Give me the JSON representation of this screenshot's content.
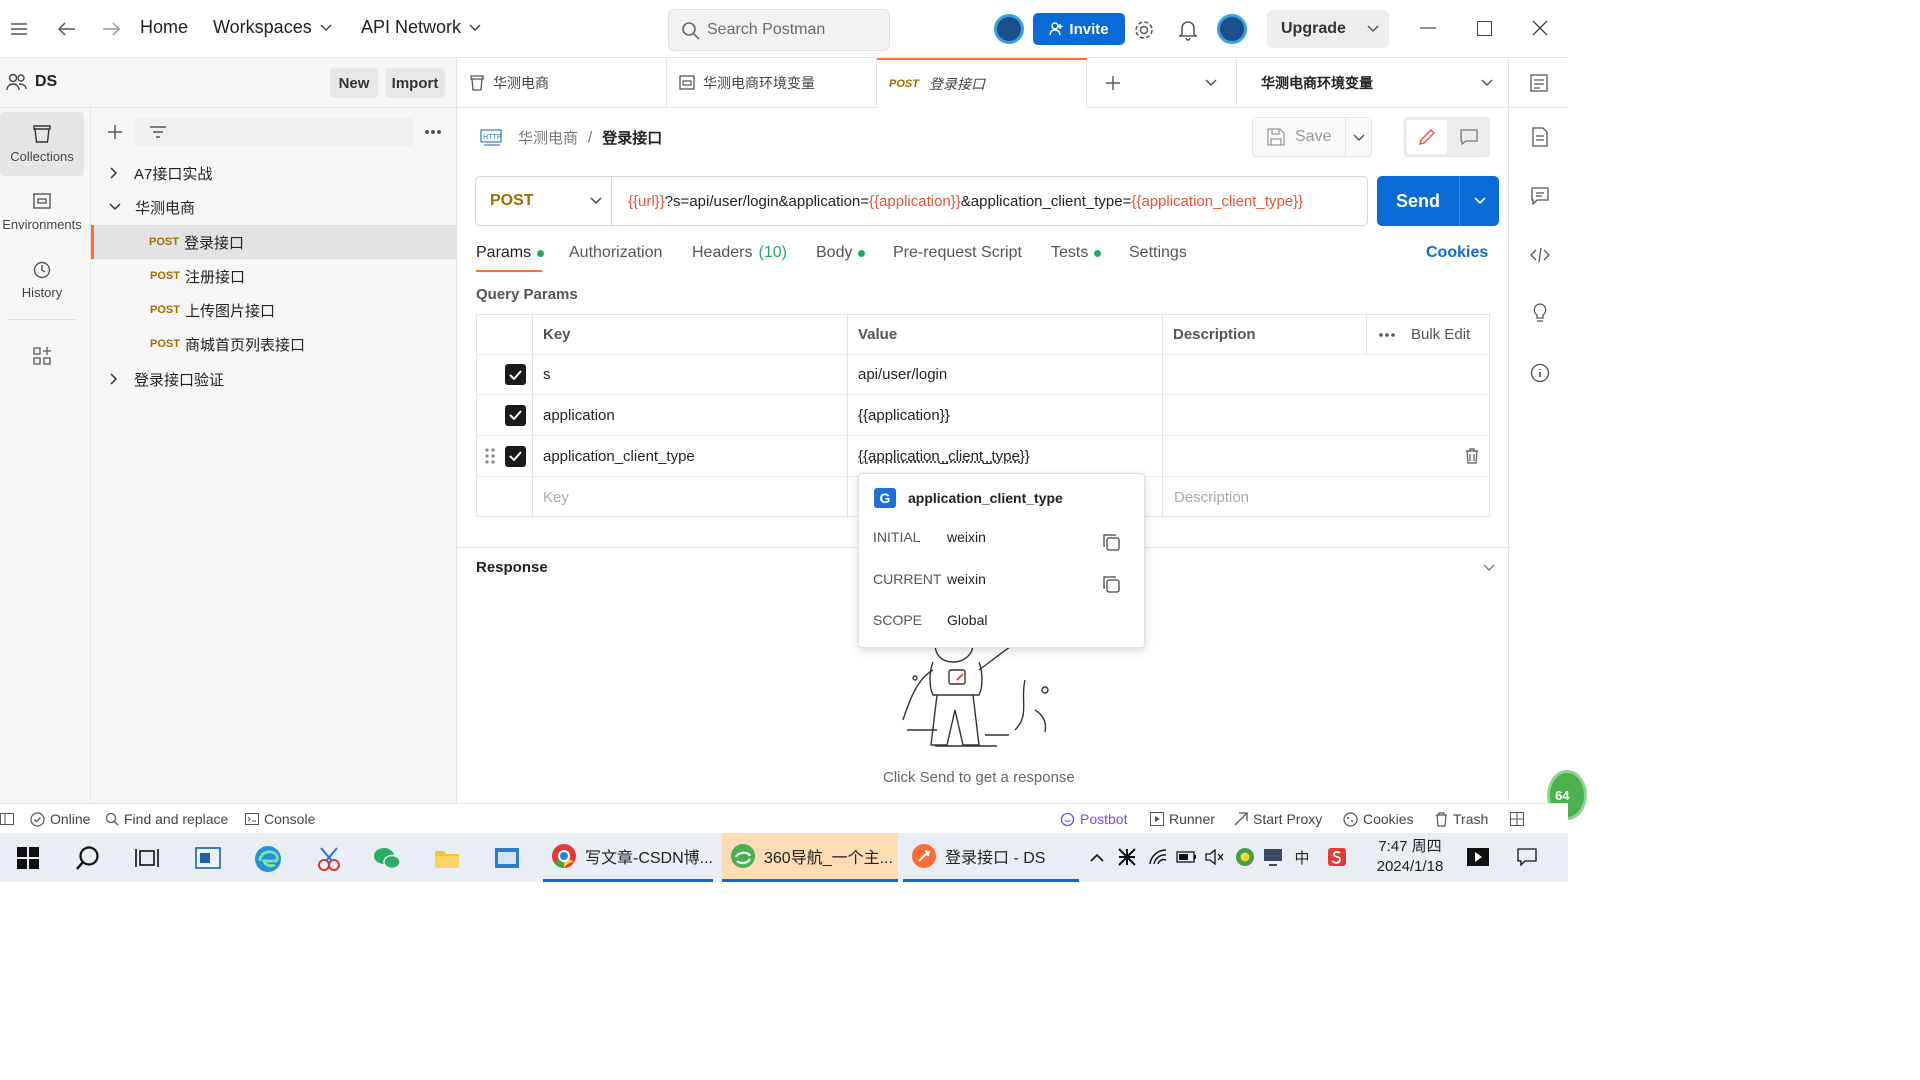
{
  "header": {
    "nav": {
      "home": "Home",
      "workspaces": "Workspaces",
      "api_network": "API Network"
    },
    "search_placeholder": "Search Postman",
    "invite_label": "Invite",
    "upgrade_label": "Upgrade"
  },
  "workspace": {
    "name": "DS",
    "new_label": "New",
    "import_label": "Import"
  },
  "rail": {
    "collections": "Collections",
    "environments": "Environments",
    "history": "History"
  },
  "tree": {
    "items": [
      {
        "label": "A7接口实战"
      },
      {
        "label": "华测电商"
      },
      {
        "method": "POST",
        "label": "登录接口"
      },
      {
        "method": "POST",
        "label": "注册接口"
      },
      {
        "method": "POST",
        "label": "上传图片接口"
      },
      {
        "method": "POST",
        "label": "商城首页列表接口"
      },
      {
        "label": "登录接口验证"
      }
    ]
  },
  "tabs": [
    {
      "label": "华测电商"
    },
    {
      "label": "华测电商环境变量"
    },
    {
      "method": "POST",
      "label": "登录接口"
    }
  ],
  "env_selector": "华测电商环境变量",
  "breadcrumb": {
    "parent": "华测电商",
    "sep": "/",
    "current": "登录接口"
  },
  "save_label": "Save",
  "request": {
    "method": "POST",
    "url_parts": {
      "v1": "{{url}}",
      "t1": "?s=api/user/login&application=",
      "v2": "{{application}}",
      "t2": "&application_client_type=",
      "v3": "{{application_client_type}}"
    },
    "send_label": "Send"
  },
  "subtabs": {
    "params": "Params",
    "authorization": "Authorization",
    "headers": "Headers",
    "headers_count": "(10)",
    "body": "Body",
    "prerequest": "Pre-request Script",
    "tests": "Tests",
    "settings": "Settings",
    "cookies": "Cookies"
  },
  "query_params": {
    "title": "Query Params",
    "columns": {
      "key": "Key",
      "value": "Value",
      "description": "Description",
      "bulk_edit": "Bulk Edit"
    },
    "rows": [
      {
        "key": "s",
        "value": "api/user/login"
      },
      {
        "key": "application",
        "value": "{{application}}"
      },
      {
        "key": "application_client_type",
        "value": "{{application_client_type}}"
      }
    ],
    "placeholders": {
      "key": "Key",
      "description": "Description"
    }
  },
  "popup": {
    "badge": "G",
    "name": "application_client_type",
    "initial_label": "INITIAL",
    "initial_value": "weixin",
    "current_label": "CURRENT",
    "current_value": "weixin",
    "scope_label": "SCOPE",
    "scope_value": "Global"
  },
  "response": {
    "title": "Response",
    "empty": "Click Send to get a response"
  },
  "statusbar": {
    "online": "Online",
    "find": "Find and replace",
    "console": "Console",
    "postbot": "Postbot",
    "runner": "Runner",
    "proxy": "Start Proxy",
    "cookies": "Cookies",
    "trash": "Trash"
  },
  "taskbar": {
    "apps": [
      {
        "label": "写文章-CSDN博..."
      },
      {
        "label": "360导航_一个主..."
      },
      {
        "label": "登录接口 - DS"
      }
    ],
    "time": "7:47 周四",
    "date": "2024/1/18",
    "ime": "中"
  },
  "colors": {
    "accent": "#ff6c37",
    "primary": "#0b6bd6",
    "variable": "#e8523a",
    "method": "#a06d00",
    "ok_dot": "#27a85f"
  }
}
